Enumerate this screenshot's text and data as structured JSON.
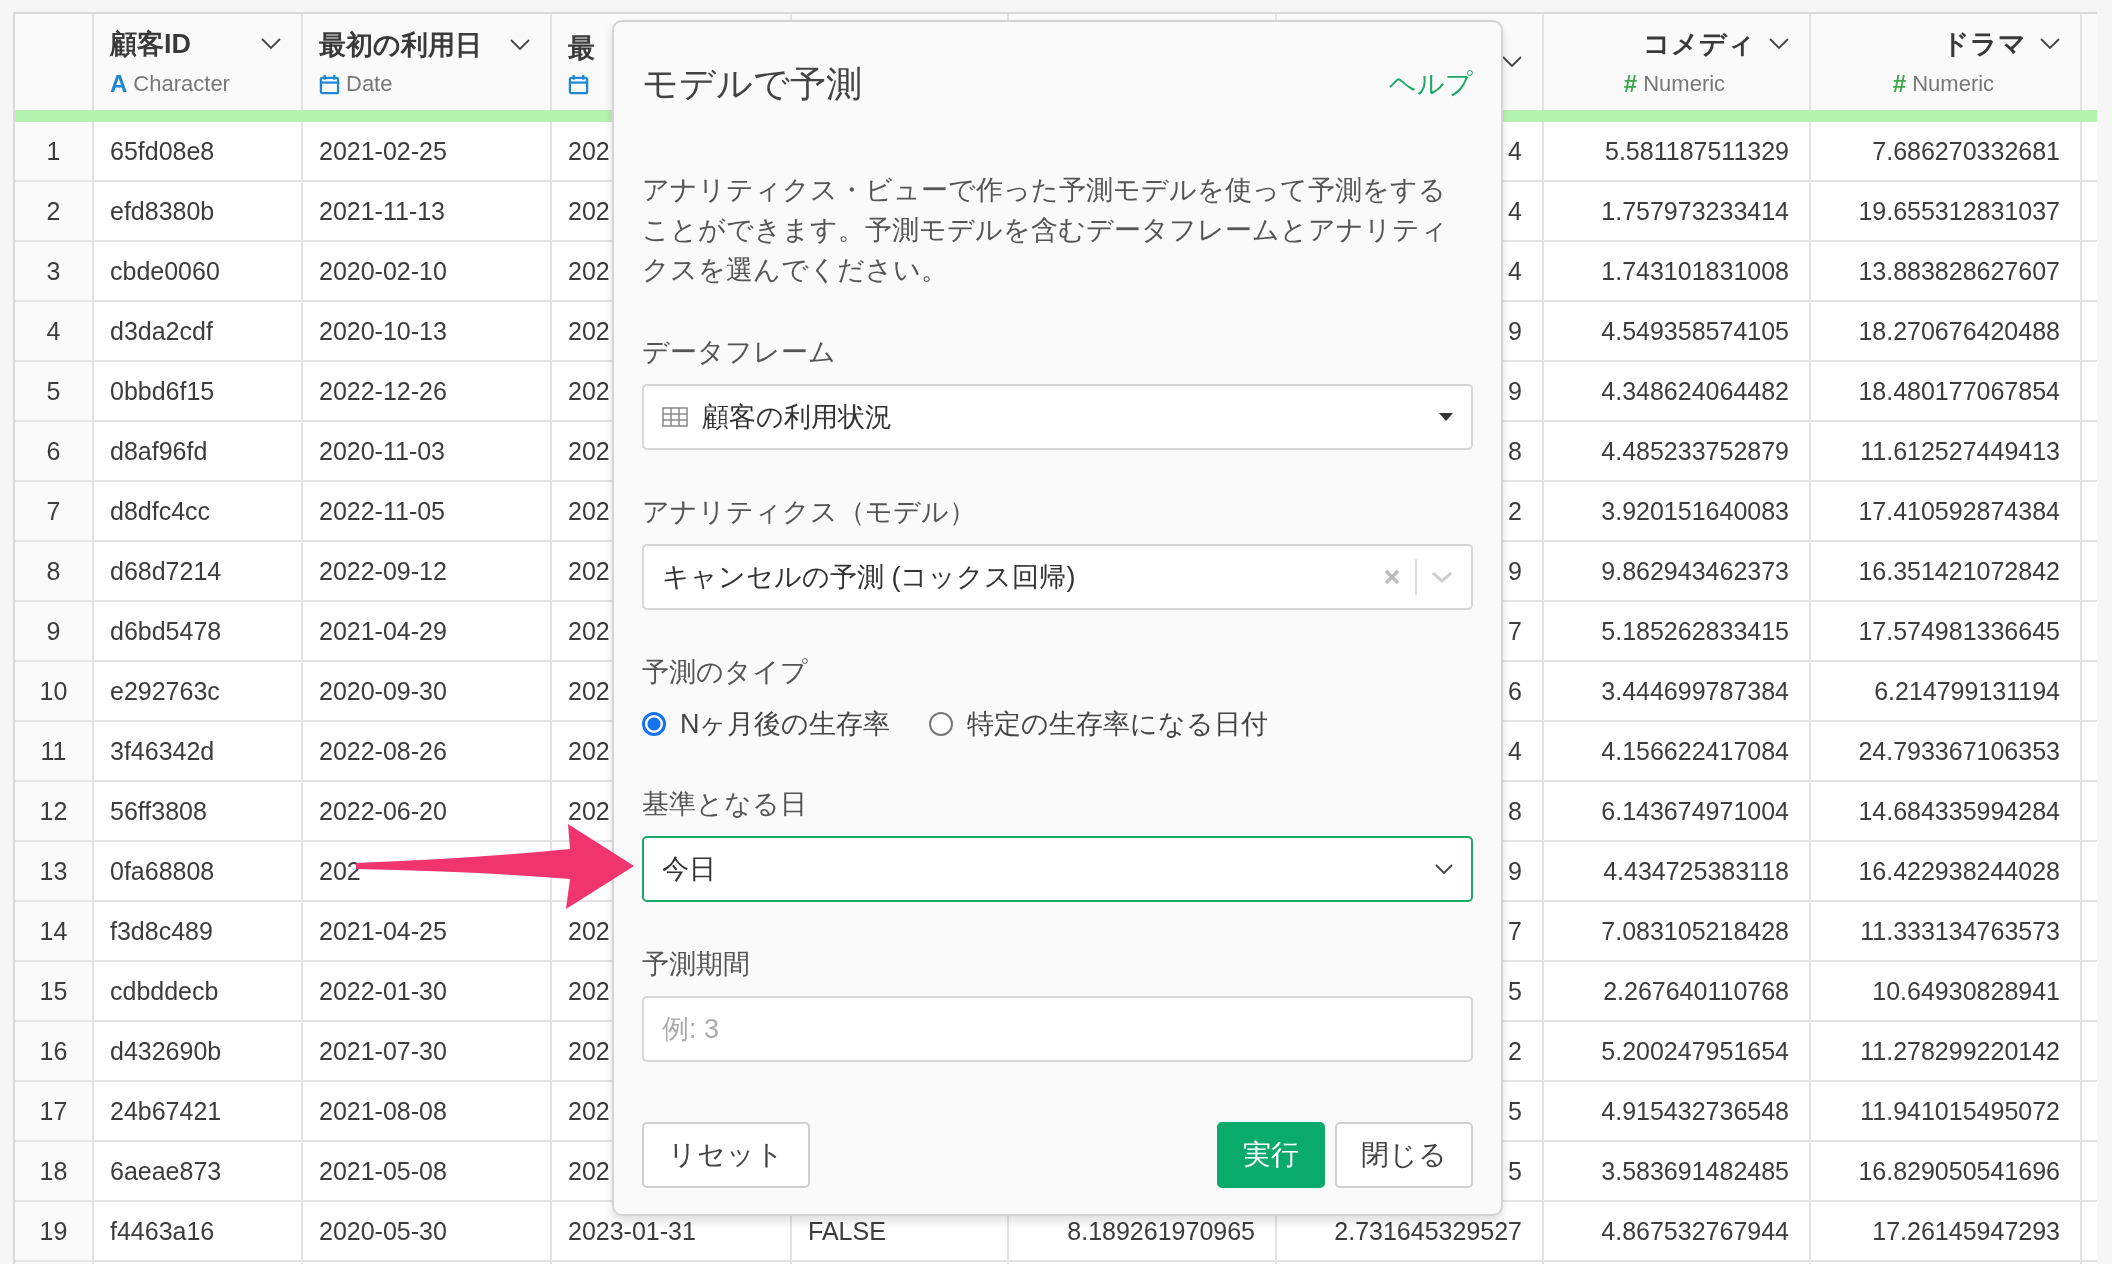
{
  "table": {
    "columns": [
      {
        "kind": "character",
        "name": "顧客ID",
        "type_symbol": "A",
        "type": "Character"
      },
      {
        "kind": "date",
        "name": "最初の利用日",
        "type": "Date"
      },
      {
        "kind": "date",
        "name": "最"
      },
      {
        "kind": "logical"
      },
      {
        "kind": "covered_numeric"
      },
      {
        "kind": "numeric"
      },
      {
        "kind": "numeric",
        "name": "コメディ",
        "type_symbol": "#",
        "type": "Numeric"
      },
      {
        "kind": "numeric",
        "name": "ドラマ",
        "type_symbol": "#",
        "type": "Numeric"
      }
    ],
    "rows": [
      {
        "number": "1",
        "cells": [
          "65fd08e8",
          "2021-02-25",
          "202",
          null,
          null,
          "4",
          "5.581187511329",
          "7.686270332681"
        ]
      },
      {
        "number": "2",
        "cells": [
          "efd8380b",
          "2021-11-13",
          "202",
          null,
          null,
          "4",
          "1.757973233414",
          "19.655312831037"
        ]
      },
      {
        "number": "3",
        "cells": [
          "cbde0060",
          "2020-02-10",
          "202",
          null,
          null,
          "4",
          "1.743101831008",
          "13.883828627607"
        ]
      },
      {
        "number": "4",
        "cells": [
          "d3da2cdf",
          "2020-10-13",
          "202",
          null,
          null,
          "9",
          "4.549358574105",
          "18.270676420488"
        ]
      },
      {
        "number": "5",
        "cells": [
          "0bbd6f15",
          "2022-12-26",
          "202",
          null,
          null,
          "9",
          "4.348624064482",
          "18.480177067854"
        ]
      },
      {
        "number": "6",
        "cells": [
          "d8af96fd",
          "2020-11-03",
          "202",
          null,
          null,
          "8",
          "4.485233752879",
          "11.612527449413"
        ]
      },
      {
        "number": "7",
        "cells": [
          "d8dfc4cc",
          "2022-11-05",
          "202",
          null,
          null,
          "2",
          "3.920151640083",
          "17.410592874384"
        ]
      },
      {
        "number": "8",
        "cells": [
          "d68d7214",
          "2022-09-12",
          "202",
          null,
          null,
          "9",
          "9.862943462373",
          "16.351421072842"
        ]
      },
      {
        "number": "9",
        "cells": [
          "d6bd5478",
          "2021-04-29",
          "202",
          null,
          null,
          "7",
          "5.185262833415",
          "17.574981336645"
        ]
      },
      {
        "number": "10",
        "cells": [
          "e292763c",
          "2020-09-30",
          "202",
          null,
          null,
          "6",
          "3.444699787384",
          "6.214799131194"
        ]
      },
      {
        "number": "11",
        "cells": [
          "3f46342d",
          "2022-08-26",
          "202",
          null,
          null,
          "4",
          "4.156622417084",
          "24.793367106353"
        ]
      },
      {
        "number": "12",
        "cells": [
          "56ff3808",
          "2022-06-20",
          "202",
          null,
          null,
          "8",
          "6.143674971004",
          "14.684335994284"
        ]
      },
      {
        "number": "13",
        "cells": [
          "0fa68808",
          "202",
          null,
          null,
          null,
          "9",
          "4.434725383118",
          "16.422938244028"
        ]
      },
      {
        "number": "14",
        "cells": [
          "f3d8c489",
          "2021-04-25",
          "202",
          null,
          null,
          "7",
          "7.083105218428",
          "11.333134763573"
        ]
      },
      {
        "number": "15",
        "cells": [
          "cdbddecb",
          "2022-01-30",
          "202",
          null,
          null,
          "5",
          "2.267640110768",
          "10.64930828941"
        ]
      },
      {
        "number": "16",
        "cells": [
          "d432690b",
          "2021-07-30",
          "202",
          null,
          null,
          "2",
          "5.200247951654",
          "11.278299220142"
        ]
      },
      {
        "number": "17",
        "cells": [
          "24b67421",
          "2021-08-08",
          "202",
          null,
          null,
          "5",
          "4.915432736548",
          "11.941015495072"
        ]
      },
      {
        "number": "18",
        "cells": [
          "6aeae873",
          "2021-05-08",
          "202",
          null,
          null,
          "5",
          "3.583691482485",
          "16.829050541696"
        ]
      },
      {
        "number": "19",
        "cells": [
          "f4463a16",
          "2020-05-30",
          "2023-01-31",
          "FALSE",
          "8.189261970965",
          "2.731645329527",
          "4.867532767944",
          "17.26145947293"
        ]
      }
    ]
  },
  "dialog": {
    "title": "モデルで予測",
    "help_link": "ヘルプ",
    "description": "アナリティクス・ビューで作った予測モデルを使って予測をすることができます。予測モデルを含むデータフレームとアナリティクスを選んでください。",
    "fields": [
      {
        "kind": "table_select",
        "label": "データフレーム",
        "value": "顧客の利用状況",
        "focused": false
      },
      {
        "kind": "clearable_select",
        "label": "アナリティクス（モデル）",
        "value": "キャンセルの予測 (コックス回帰)",
        "focused": false
      },
      {
        "kind": "radio_group",
        "label": "予測のタイプ",
        "options": [
          {
            "label": "Nヶ月後の生存率",
            "selected": true
          },
          {
            "label": "特定の生存率になる日付",
            "selected": false
          }
        ]
      },
      {
        "kind": "select",
        "label": "基準となる日",
        "value": "今日",
        "focused": true
      },
      {
        "kind": "text_input",
        "label": "予測期間",
        "placeholder": "例: 3",
        "focused": false
      }
    ],
    "buttons": [
      {
        "label": "リセット",
        "kind": "reset"
      },
      {
        "label": "実行",
        "kind": "primary"
      },
      {
        "label": "閉じる",
        "kind": "close"
      }
    ]
  }
}
